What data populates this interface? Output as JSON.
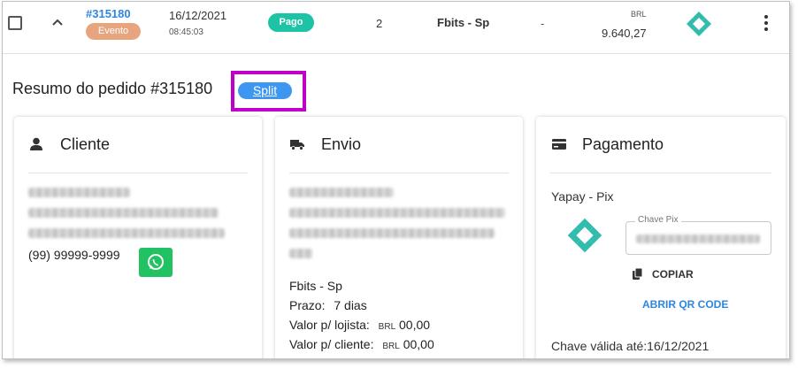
{
  "order": {
    "id": "#315180",
    "tag": "Evento",
    "date": "16/12/2021",
    "time": "08:45:03",
    "status": "Pago",
    "quantity": "2",
    "store": "Fbits - Sp",
    "dash": "-",
    "currency": "BRL",
    "amount": "9.640,27"
  },
  "summary": {
    "title": "Resumo do pedido #315180",
    "split_label": "Split"
  },
  "cliente": {
    "title": "Cliente",
    "phone": "(99) 99999-9999"
  },
  "envio": {
    "title": "Envio",
    "store": "Fbits - Sp",
    "prazo_label": "Prazo:",
    "prazo_value": "7 dias",
    "lojista_label": "Valor p/ lojista:",
    "cliente_label": "Valor p/ cliente:",
    "currency": "BRL",
    "lojista_value": "00,00",
    "cliente_value": "00,00"
  },
  "pagamento": {
    "title": "Pagamento",
    "method": "Yapay - Pix",
    "chave_label": "Chave Pix",
    "copy_label": "COPIAR",
    "qr_label": "ABRIR QR CODE",
    "valid_text": "Chave válida até:16/12/2021"
  },
  "colors": {
    "pix": "#32bcad",
    "link": "#2e86de",
    "highlight": "#c000c8",
    "whatsapp": "#21c262"
  }
}
